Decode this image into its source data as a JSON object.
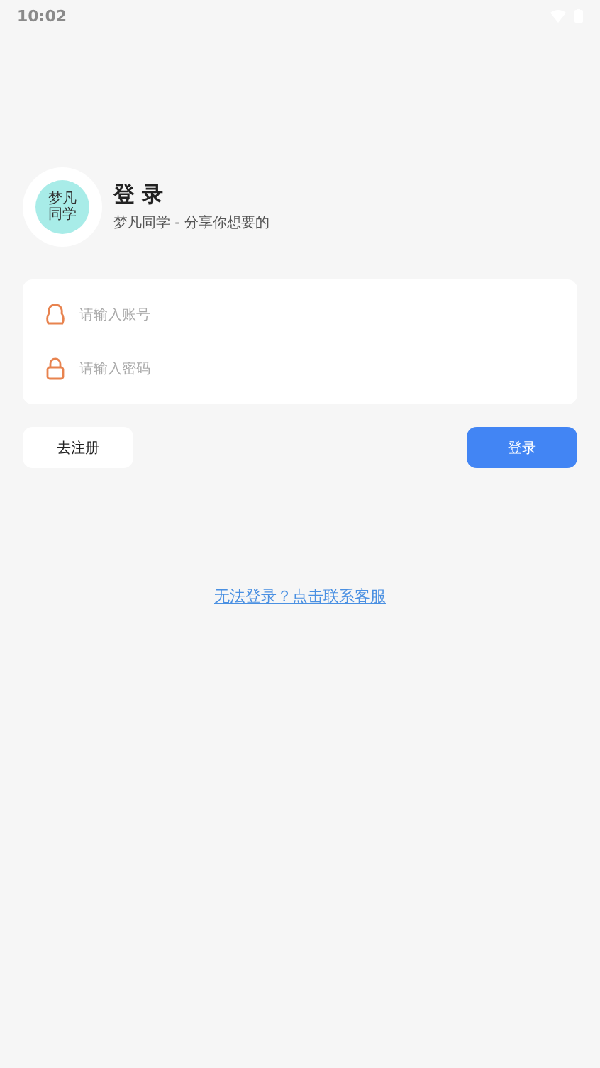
{
  "status_bar": {
    "time": "10:02"
  },
  "header": {
    "logo_text": "梦凡同学",
    "title": "登 录",
    "subtitle": "梦凡同学 - 分享你想要的"
  },
  "form": {
    "fields": [
      {
        "kind": "account",
        "placeholder": "请输入账号"
      },
      {
        "kind": "password",
        "placeholder": "请输入密码"
      }
    ]
  },
  "buttons": [
    {
      "kind": "secondary",
      "label": "去注册"
    },
    {
      "kind": "primary",
      "label": "登录"
    }
  ],
  "help_link": "无法登录？点击联系客服"
}
